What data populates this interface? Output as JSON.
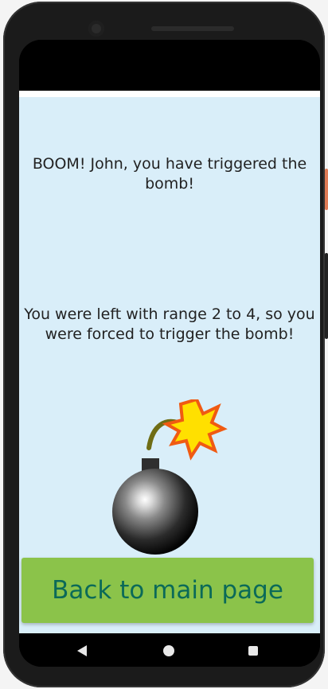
{
  "screen": {
    "message_1": "BOOM! John, you have triggered the bomb!",
    "message_2": "You were left with range 2 to 4, so you were forced to trigger the bomb!",
    "back_button_label": "Back to main page"
  },
  "icons": {
    "bomb": "bomb-icon",
    "nav_back": "back-triangle-icon",
    "nav_home": "home-circle-icon",
    "nav_recents": "recents-square-icon"
  },
  "colors": {
    "content_background": "#d9eef9",
    "button_background": "#8bc34a",
    "button_text": "#0b6a58",
    "phone_frame": "#1b1b1b"
  }
}
